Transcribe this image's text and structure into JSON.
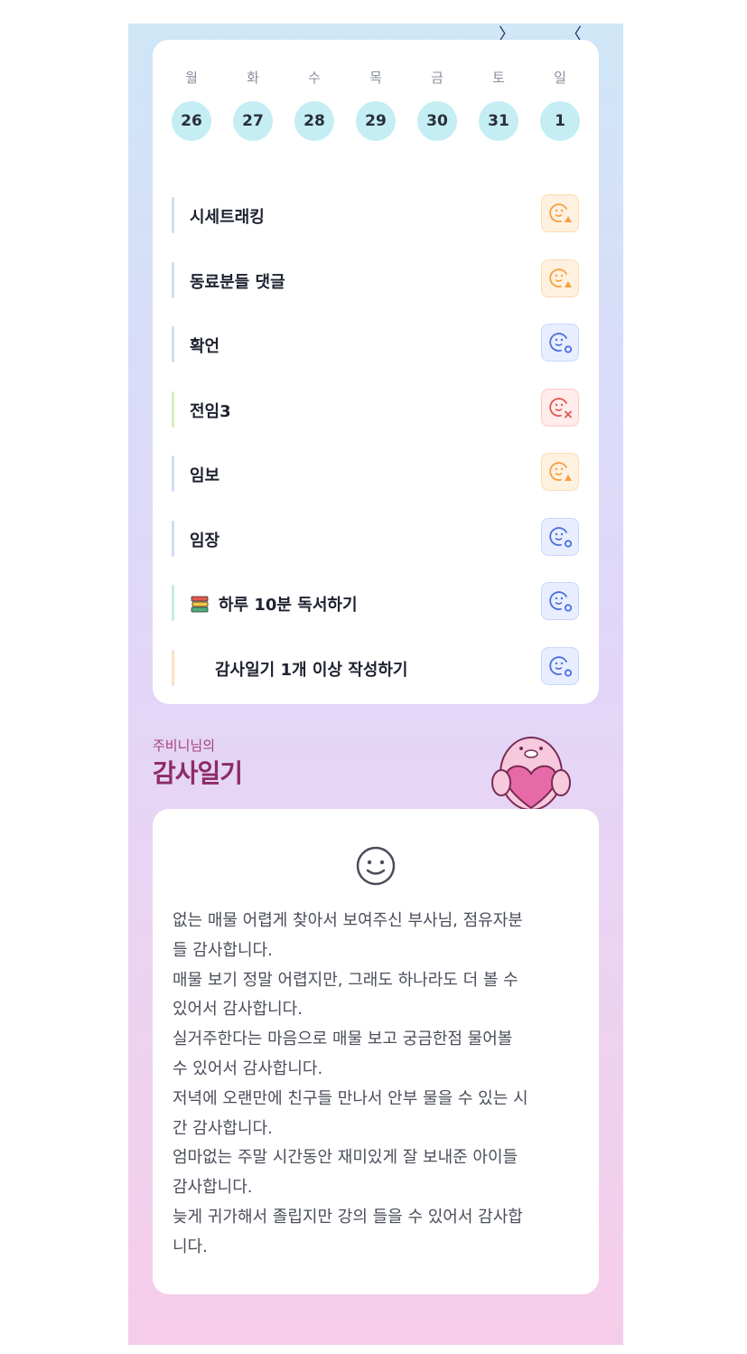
{
  "calendar": {
    "weekdays": [
      "월",
      "화",
      "수",
      "목",
      "금",
      "토",
      "일"
    ],
    "dates": [
      "26",
      "27",
      "28",
      "29",
      "30",
      "31",
      "1"
    ]
  },
  "habits": [
    {
      "title": "시세트래킹",
      "status": "warn",
      "bar_color": "#d4dcf5",
      "emoji": ""
    },
    {
      "title": "동료분들 댓글",
      "status": "warn",
      "bar_color": "#d4dcf5",
      "emoji": ""
    },
    {
      "title": "확언",
      "status": "ok",
      "bar_color": "#d4dcf5",
      "emoji": ""
    },
    {
      "title": "전임3",
      "status": "bad",
      "bar_color": "#d9ecc0",
      "emoji": ""
    },
    {
      "title": "임보",
      "status": "warn",
      "bar_color": "#d4dcf5",
      "emoji": ""
    },
    {
      "title": "임장",
      "status": "ok",
      "bar_color": "#d4dcf5",
      "emoji": ""
    },
    {
      "title": "하루 10분 독서하기",
      "status": "ok",
      "bar_color": "#c8efd8",
      "emoji": "books-icon"
    },
    {
      "title": "감사일기 1개 이상 작성하기",
      "status": "ok",
      "bar_color": "#fde0c2",
      "emoji": "blank"
    }
  ],
  "gratitude": {
    "subtitle": "주비니님의",
    "title": "감사일기",
    "lines": [
      "없는 매물 어렵게 찾아서 보여주신 부사님, 점유자분",
      "들 감사합니다.",
      "매물 보기 정말 어렵지만, 그래도 하나라도 더 볼 수",
      "있어서 감사합니다.",
      "실거주한다는 마음으로 매물 보고 궁금한점 물어볼",
      "수 있어서 감사합니다.",
      "저녁에 오랜만에 친구들 만나서 안부 물을 수 있는 시",
      "간 감사합니다.",
      "엄마없는 주말 시간동안 재미있게 잘 보내준 아이들",
      "감사합니다.",
      "늦게 귀가해서 졸립지만 강의 들을 수 있어서 감사합",
      "니다."
    ]
  },
  "colors": {
    "warn": "#f5a042",
    "ok": "#4a6ee0",
    "bad": "#e0584e",
    "date_bg": "#c4eef3",
    "title_accent": "#8d2c64"
  }
}
